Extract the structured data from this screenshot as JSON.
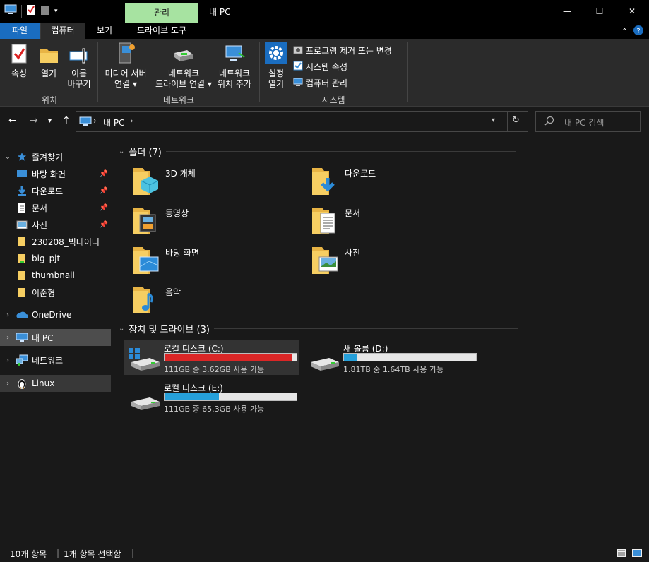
{
  "titlebar": {
    "context_tab": "관리",
    "title": "내 PC",
    "minimize": "—",
    "maximize": "☐",
    "close": "✕"
  },
  "tabs": {
    "file": "파일",
    "computer": "컴퓨터",
    "view": "보기",
    "drive_tools": "드라이브 도구"
  },
  "ribbon": {
    "properties": "속성",
    "open": "열기",
    "rename_1": "이름",
    "rename_2": "바꾸기",
    "group_location": "위치",
    "media_server_1": "미디어 서버",
    "media_server_2": "연결",
    "map_drive_1": "네트워크",
    "map_drive_2": "드라이브 연결",
    "add_location_1": "네트워크",
    "add_location_2": "위치 추가",
    "group_network": "네트워크",
    "settings_1": "설정",
    "settings_2": "열기",
    "uninstall": "프로그램 제거 또는 변경",
    "system_props": "시스템 속성",
    "manage": "컴퓨터 관리",
    "group_system": "시스템"
  },
  "address": {
    "path": "내 PC",
    "search_placeholder": "내 PC 검색"
  },
  "sidebar": {
    "quick_access": "즐겨찾기",
    "items": [
      {
        "label": "바탕 화면"
      },
      {
        "label": "다운로드"
      },
      {
        "label": "문서"
      },
      {
        "label": "사진"
      },
      {
        "label": "230208_빅데이터"
      },
      {
        "label": "big_pjt"
      },
      {
        "label": "thumbnail"
      },
      {
        "label": "이준형"
      }
    ],
    "onedrive": "OneDrive",
    "this_pc": "내 PC",
    "network": "네트워크",
    "linux": "Linux"
  },
  "folders_section": "폴더 (7)",
  "folders": [
    {
      "label": "3D 개체"
    },
    {
      "label": "다운로드"
    },
    {
      "label": "동영상"
    },
    {
      "label": "문서"
    },
    {
      "label": "바탕 화면"
    },
    {
      "label": "사진"
    },
    {
      "label": "음악"
    }
  ],
  "drives_section": "장치 및 드라이브 (3)",
  "drives": [
    {
      "label": "로컬 디스크 (C:)",
      "info": "111GB 중 3.62GB 사용 가능",
      "used_fraction": 0.97,
      "color": "#da2626"
    },
    {
      "label": "새 볼륨 (D:)",
      "info": "1.81TB 중 1.64TB 사용 가능",
      "used_fraction": 0.1,
      "color": "#26a0da"
    },
    {
      "label": "로컬 디스크 (E:)",
      "info": "111GB 중 65.3GB 사용 가능",
      "used_fraction": 0.41,
      "color": "#26a0da"
    }
  ],
  "status": {
    "count": "10개 항목",
    "selected": "1개 항목 선택함"
  }
}
